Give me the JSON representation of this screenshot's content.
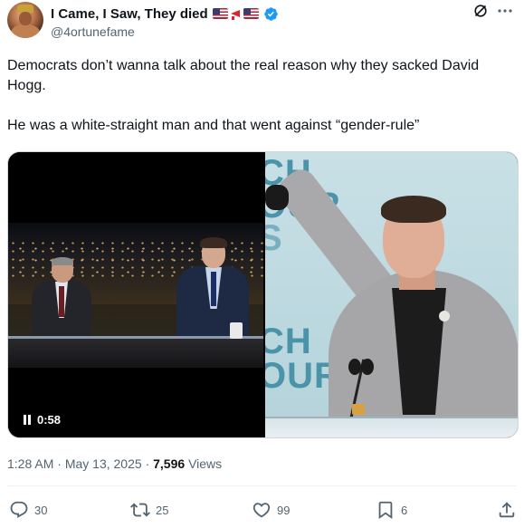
{
  "author": {
    "display_name": "I Came, I Saw, They died",
    "handle": "@4ortunefame"
  },
  "tweet": {
    "paragraphs": [
      "Democrats don’t wanna talk about the real reason why they sacked David Hogg.",
      "He was a white-straight man and that went against “gender-rule”"
    ]
  },
  "media": {
    "video_time": "0:58",
    "photo_sign_lines": [
      "CH",
      "OUR",
      "S",
      "CH",
      "OUR"
    ]
  },
  "meta": {
    "time": "1:28 AM",
    "separator": "·",
    "date": "May 13, 2025",
    "views_count": "7,596",
    "views_label": "Views"
  },
  "actions": {
    "replies": "30",
    "reposts": "25",
    "likes": "99",
    "bookmarks": "6"
  },
  "icons": {
    "verified": "verified-badge-icon",
    "grok": "grok-icon",
    "more": "more-icon",
    "reply": "reply-icon",
    "repost": "repost-icon",
    "like": "like-icon",
    "bookmark": "bookmark-icon",
    "share": "share-icon"
  },
  "colors": {
    "verified_blue": "#1d9bf0",
    "text_primary": "#0f1419",
    "text_secondary": "#536471"
  }
}
